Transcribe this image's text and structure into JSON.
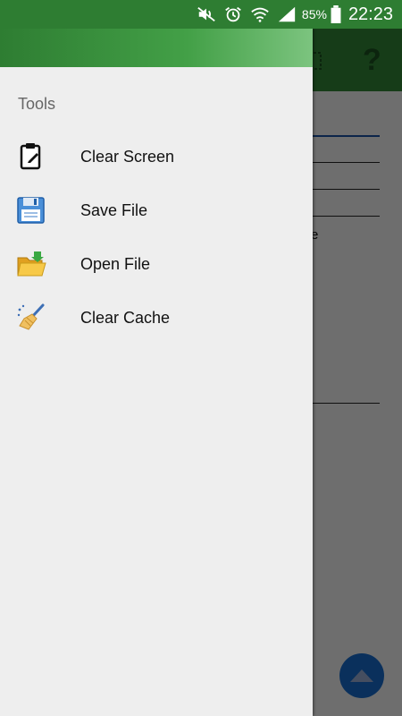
{
  "status_bar": {
    "battery": "85%",
    "time": "22:23",
    "icons": [
      "mute-icon",
      "alarm-icon",
      "wifi-icon",
      "signal-icon",
      "battery-icon"
    ]
  },
  "drawer": {
    "section_title": "Tools",
    "items": [
      {
        "label": "Clear Screen",
        "icon": "clipboard-icon"
      },
      {
        "label": "Save File",
        "icon": "floppy-disk-icon"
      },
      {
        "label": "Open File",
        "icon": "open-folder-icon"
      },
      {
        "label": "Clear Cache",
        "icon": "broom-icon"
      }
    ]
  },
  "background": {
    "toolbar_color": "#2e7d32",
    "fragment_text": "e",
    "help_icon": "?"
  },
  "colors": {
    "primary": "#2e7d32",
    "drawer_bg": "#eeeeee",
    "fab": "#1565c0"
  }
}
